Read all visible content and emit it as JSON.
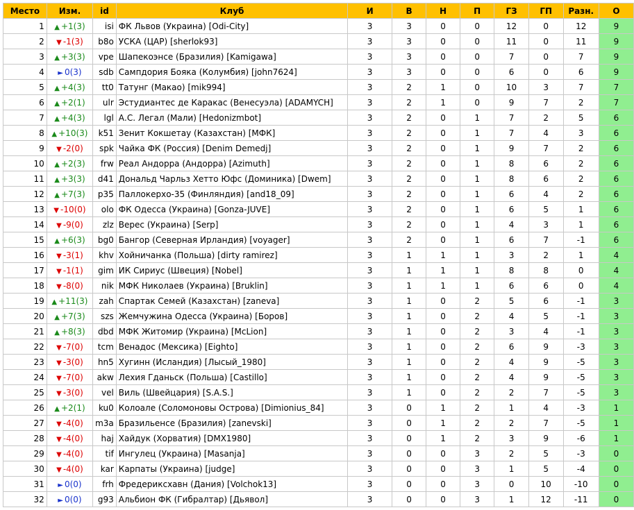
{
  "headers": [
    "Место",
    "Изм.",
    "id",
    "Клуб",
    "И",
    "В",
    "Н",
    "П",
    "ГЗ",
    "ГП",
    "Разн.",
    "О"
  ],
  "colors": {
    "header_bg": "#ffc000",
    "points_bg": "#90ee90",
    "up": "#1a8a1a",
    "down": "#dd0000",
    "same": "#1a33cc"
  },
  "icons": {
    "up": "triangle-up-icon",
    "down": "triangle-down-icon",
    "same": "triangle-right-icon"
  },
  "rows": [
    {
      "pos": "1",
      "dir": "up",
      "chg": "+1(3)",
      "id": "isi",
      "club": "ФК Львов (Украина) [Odi-City]",
      "p": "3",
      "w": "3",
      "d": "0",
      "l": "0",
      "gf": "12",
      "ga": "0",
      "gd": "12",
      "pts": "9"
    },
    {
      "pos": "2",
      "dir": "down",
      "chg": "-1(3)",
      "id": "b8o",
      "club": "УСКА (ЦАР) [sherlok93]",
      "p": "3",
      "w": "3",
      "d": "0",
      "l": "0",
      "gf": "11",
      "ga": "0",
      "gd": "11",
      "pts": "9"
    },
    {
      "pos": "3",
      "dir": "up",
      "chg": "+3(3)",
      "id": "vpe",
      "club": "Шапекоэнсе (Бразилия) [Kamigawa]",
      "p": "3",
      "w": "3",
      "d": "0",
      "l": "0",
      "gf": "7",
      "ga": "0",
      "gd": "7",
      "pts": "9"
    },
    {
      "pos": "4",
      "dir": "same",
      "chg": "0(3)",
      "id": "sdb",
      "club": "Сампдория Бояка (Колумбия) [john7624]",
      "p": "3",
      "w": "3",
      "d": "0",
      "l": "0",
      "gf": "6",
      "ga": "0",
      "gd": "6",
      "pts": "9"
    },
    {
      "pos": "5",
      "dir": "up",
      "chg": "+4(3)",
      "id": "tt0",
      "club": "Татунг (Макао) [mik994]",
      "p": "3",
      "w": "2",
      "d": "1",
      "l": "0",
      "gf": "10",
      "ga": "3",
      "gd": "7",
      "pts": "7"
    },
    {
      "pos": "6",
      "dir": "up",
      "chg": "+2(1)",
      "id": "ulr",
      "club": "Эстудиантес де Каракас (Венесуэла) [ADAMYCH]",
      "p": "3",
      "w": "2",
      "d": "1",
      "l": "0",
      "gf": "9",
      "ga": "7",
      "gd": "2",
      "pts": "7"
    },
    {
      "pos": "7",
      "dir": "up",
      "chg": "+4(3)",
      "id": "lgl",
      "club": "А.С. Легал (Мали) [Hedonizmbot]",
      "p": "3",
      "w": "2",
      "d": "0",
      "l": "1",
      "gf": "7",
      "ga": "2",
      "gd": "5",
      "pts": "6"
    },
    {
      "pos": "8",
      "dir": "up",
      "chg": "+10(3)",
      "id": "k51",
      "club": "Зенит Кокшетау (Казахстан) [МФК]",
      "p": "3",
      "w": "2",
      "d": "0",
      "l": "1",
      "gf": "7",
      "ga": "4",
      "gd": "3",
      "pts": "6"
    },
    {
      "pos": "9",
      "dir": "down",
      "chg": "-2(0)",
      "id": "spk",
      "club": "Чайка ФК (Россия) [Denim Demedj]",
      "p": "3",
      "w": "2",
      "d": "0",
      "l": "1",
      "gf": "9",
      "ga": "7",
      "gd": "2",
      "pts": "6"
    },
    {
      "pos": "10",
      "dir": "up",
      "chg": "+2(3)",
      "id": "frw",
      "club": "Реал Андорра (Андорра) [Azimuth]",
      "p": "3",
      "w": "2",
      "d": "0",
      "l": "1",
      "gf": "8",
      "ga": "6",
      "gd": "2",
      "pts": "6"
    },
    {
      "pos": "11",
      "dir": "up",
      "chg": "+3(3)",
      "id": "d41",
      "club": "Дональд Чарльз Хетто Юфс (Доминика) [Dwem]",
      "p": "3",
      "w": "2",
      "d": "0",
      "l": "1",
      "gf": "8",
      "ga": "6",
      "gd": "2",
      "pts": "6"
    },
    {
      "pos": "12",
      "dir": "up",
      "chg": "+7(3)",
      "id": "p35",
      "club": "Паллокерхо-35 (Финляндия) [and18_09]",
      "p": "3",
      "w": "2",
      "d": "0",
      "l": "1",
      "gf": "6",
      "ga": "4",
      "gd": "2",
      "pts": "6"
    },
    {
      "pos": "13",
      "dir": "down",
      "chg": "-10(0)",
      "id": "olo",
      "club": "ФК Одесса (Украина) [Gonza-JUVE]",
      "p": "3",
      "w": "2",
      "d": "0",
      "l": "1",
      "gf": "6",
      "ga": "5",
      "gd": "1",
      "pts": "6"
    },
    {
      "pos": "14",
      "dir": "down",
      "chg": "-9(0)",
      "id": "zlz",
      "club": "Верес (Украина) [Serp]",
      "p": "3",
      "w": "2",
      "d": "0",
      "l": "1",
      "gf": "4",
      "ga": "3",
      "gd": "1",
      "pts": "6"
    },
    {
      "pos": "15",
      "dir": "up",
      "chg": "+6(3)",
      "id": "bg0",
      "club": "Бангор (Северная Ирландия) [voyager]",
      "p": "3",
      "w": "2",
      "d": "0",
      "l": "1",
      "gf": "6",
      "ga": "7",
      "gd": "-1",
      "pts": "6"
    },
    {
      "pos": "16",
      "dir": "down",
      "chg": "-3(1)",
      "id": "khv",
      "club": "Хойничанка (Польша) [dirty ramirez]",
      "p": "3",
      "w": "1",
      "d": "1",
      "l": "1",
      "gf": "3",
      "ga": "2",
      "gd": "1",
      "pts": "4"
    },
    {
      "pos": "17",
      "dir": "down",
      "chg": "-1(1)",
      "id": "gim",
      "club": "ИК Сириус (Швеция) [Nobel]",
      "p": "3",
      "w": "1",
      "d": "1",
      "l": "1",
      "gf": "8",
      "ga": "8",
      "gd": "0",
      "pts": "4"
    },
    {
      "pos": "18",
      "dir": "down",
      "chg": "-8(0)",
      "id": "nik",
      "club": "МФК Николаев (Украина) [Bruklin]",
      "p": "3",
      "w": "1",
      "d": "1",
      "l": "1",
      "gf": "6",
      "ga": "6",
      "gd": "0",
      "pts": "4"
    },
    {
      "pos": "19",
      "dir": "up",
      "chg": "+11(3)",
      "id": "zah",
      "club": "Спартак Семей (Казахстан) [zaneva]",
      "p": "3",
      "w": "1",
      "d": "0",
      "l": "2",
      "gf": "5",
      "ga": "6",
      "gd": "-1",
      "pts": "3"
    },
    {
      "pos": "20",
      "dir": "up",
      "chg": "+7(3)",
      "id": "szs",
      "club": "Жемчужина Одесса (Украина) [Боров]",
      "p": "3",
      "w": "1",
      "d": "0",
      "l": "2",
      "gf": "4",
      "ga": "5",
      "gd": "-1",
      "pts": "3"
    },
    {
      "pos": "21",
      "dir": "up",
      "chg": "+8(3)",
      "id": "dbd",
      "club": "МФК Житомир (Украина) [McLion]",
      "p": "3",
      "w": "1",
      "d": "0",
      "l": "2",
      "gf": "3",
      "ga": "4",
      "gd": "-1",
      "pts": "3"
    },
    {
      "pos": "22",
      "dir": "down",
      "chg": "-7(0)",
      "id": "tcm",
      "club": "Венадос (Мексика) [Eighto]",
      "p": "3",
      "w": "1",
      "d": "0",
      "l": "2",
      "gf": "6",
      "ga": "9",
      "gd": "-3",
      "pts": "3"
    },
    {
      "pos": "23",
      "dir": "down",
      "chg": "-3(0)",
      "id": "hn5",
      "club": "Хугинн (Исландия) [Лысый_1980]",
      "p": "3",
      "w": "1",
      "d": "0",
      "l": "2",
      "gf": "4",
      "ga": "9",
      "gd": "-5",
      "pts": "3"
    },
    {
      "pos": "24",
      "dir": "down",
      "chg": "-7(0)",
      "id": "akw",
      "club": "Лехия Гданьск (Польша) [Castillo]",
      "p": "3",
      "w": "1",
      "d": "0",
      "l": "2",
      "gf": "4",
      "ga": "9",
      "gd": "-5",
      "pts": "3"
    },
    {
      "pos": "25",
      "dir": "down",
      "chg": "-3(0)",
      "id": "vel",
      "club": "Виль (Швейцария) [S.A.S.]",
      "p": "3",
      "w": "1",
      "d": "0",
      "l": "2",
      "gf": "2",
      "ga": "7",
      "gd": "-5",
      "pts": "3"
    },
    {
      "pos": "26",
      "dir": "up",
      "chg": "+2(1)",
      "id": "ku0",
      "club": "Колоале (Соломоновы Острова) [Dimionius_84]",
      "p": "3",
      "w": "0",
      "d": "1",
      "l": "2",
      "gf": "1",
      "ga": "4",
      "gd": "-3",
      "pts": "1"
    },
    {
      "pos": "27",
      "dir": "down",
      "chg": "-4(0)",
      "id": "m3a",
      "club": "Бразильенсе (Бразилия) [zanevski]",
      "p": "3",
      "w": "0",
      "d": "1",
      "l": "2",
      "gf": "2",
      "ga": "7",
      "gd": "-5",
      "pts": "1"
    },
    {
      "pos": "28",
      "dir": "down",
      "chg": "-4(0)",
      "id": "haj",
      "club": "Хайдук (Хорватия) [DMX1980]",
      "p": "3",
      "w": "0",
      "d": "1",
      "l": "2",
      "gf": "3",
      "ga": "9",
      "gd": "-6",
      "pts": "1"
    },
    {
      "pos": "29",
      "dir": "down",
      "chg": "-4(0)",
      "id": "tif",
      "club": "Ингулец (Украина) [Masanja]",
      "p": "3",
      "w": "0",
      "d": "0",
      "l": "3",
      "gf": "2",
      "ga": "5",
      "gd": "-3",
      "pts": "0"
    },
    {
      "pos": "30",
      "dir": "down",
      "chg": "-4(0)",
      "id": "kar",
      "club": "Карпаты (Украина) [judge]",
      "p": "3",
      "w": "0",
      "d": "0",
      "l": "3",
      "gf": "1",
      "ga": "5",
      "gd": "-4",
      "pts": "0"
    },
    {
      "pos": "31",
      "dir": "same",
      "chg": "0(0)",
      "id": "frh",
      "club": "Фредериксхавн (Дания) [Volchok13]",
      "p": "3",
      "w": "0",
      "d": "0",
      "l": "3",
      "gf": "0",
      "ga": "10",
      "gd": "-10",
      "pts": "0"
    },
    {
      "pos": "32",
      "dir": "same",
      "chg": "0(0)",
      "id": "g93",
      "club": "Альбион ФК (Гибралтар) [Дьявол]",
      "p": "3",
      "w": "0",
      "d": "0",
      "l": "3",
      "gf": "1",
      "ga": "12",
      "gd": "-11",
      "pts": "0"
    }
  ]
}
